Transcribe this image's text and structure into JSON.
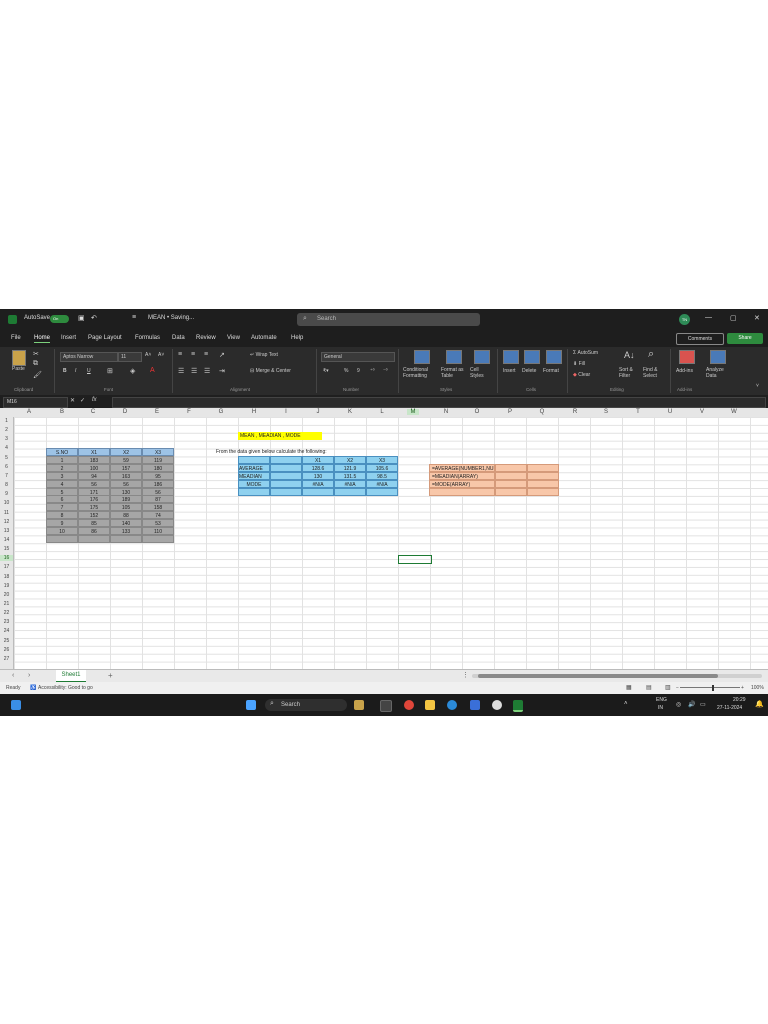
{
  "titlebar": {
    "autosave_label": "AutoSave",
    "autosave_state": "On",
    "doc_title": "MEAN • Saving...",
    "search_placeholder": "Search",
    "user_initials": "TN",
    "minimize": "—",
    "maximize": "▢",
    "close": "✕"
  },
  "menu": {
    "items": [
      "File",
      "Home",
      "Insert",
      "Page Layout",
      "Formulas",
      "Data",
      "Review",
      "View",
      "Automate",
      "Help"
    ],
    "active": "Home",
    "comments_label": "Comments",
    "share_label": "Share"
  },
  "ribbon": {
    "paste": "Paste",
    "font_name": "Aptos Narrow",
    "font_size": "11",
    "wrap_text": "Wrap Text",
    "merge_center": "Merge & Center",
    "number_format": "General",
    "conditional_formatting": "Conditional Formatting",
    "format_as_table": "Format as Table",
    "cell_styles": "Cell Styles",
    "insert": "Insert",
    "delete": "Delete",
    "format": "Format",
    "autosum": "AutoSum",
    "fill": "Fill",
    "clear": "Clear",
    "sort_filter": "Sort & Filter",
    "find_select": "Find & Select",
    "addins": "Add-ins",
    "analyze_data": "Analyze Data",
    "groups": [
      "Clipboard",
      "Font",
      "Alignment",
      "Number",
      "Styles",
      "Cells",
      "Editing",
      "Add-ins"
    ]
  },
  "formula_bar": {
    "name_box": "M16",
    "fx": "fx",
    "content": ""
  },
  "columns": [
    "A",
    "B",
    "C",
    "D",
    "E",
    "F",
    "G",
    "H",
    "I",
    "J",
    "K",
    "L",
    "M",
    "N",
    "O",
    "P",
    "Q",
    "R",
    "S",
    "T",
    "U",
    "V",
    "W"
  ],
  "selected_column": "M",
  "rows": [
    "1",
    "2",
    "3",
    "4",
    "5",
    "6",
    "7",
    "8",
    "9",
    "10",
    "11",
    "12",
    "13",
    "14",
    "15",
    "16",
    "17",
    "18",
    "19",
    "20",
    "21",
    "22",
    "23",
    "24",
    "25",
    "26",
    "27"
  ],
  "selected_row": "16",
  "data_table": {
    "headers": [
      "S.NO",
      "X1",
      "X2",
      "X3"
    ],
    "rows": [
      [
        "1",
        "183",
        "59",
        "119"
      ],
      [
        "2",
        "100",
        "157",
        "180"
      ],
      [
        "3",
        "94",
        "163",
        "95"
      ],
      [
        "4",
        "56",
        "56",
        "186"
      ],
      [
        "5",
        "171",
        "130",
        "56"
      ],
      [
        "6",
        "176",
        "189",
        "87"
      ],
      [
        "7",
        "175",
        "105",
        "158"
      ],
      [
        "8",
        "152",
        "88",
        "74"
      ],
      [
        "9",
        "85",
        "140",
        "53"
      ],
      [
        "10",
        "86",
        "133",
        "110"
      ]
    ]
  },
  "title_cell": "MEAN , MEADIAN , MODE",
  "instruction": "From the data given below calculate the following:",
  "results": {
    "headers": [
      "X1",
      "X2",
      "X3"
    ],
    "rows": [
      {
        "label": "AVERAGE",
        "values": [
          "128.6",
          "121.9",
          "105.6"
        ]
      },
      {
        "label": "MEADIAN",
        "values": [
          "130",
          "131.5",
          "98.5"
        ]
      },
      {
        "label": "MODE",
        "values": [
          "#N/A",
          "#N/A",
          "#N/A"
        ]
      }
    ]
  },
  "formulas": [
    "=AVERAGE(NUMBER1,NUMBER2)",
    "=MEADIAN(ARRAY)",
    "=MODE(ARRAY)"
  ],
  "sheet_tab": "Sheet1",
  "add_sheet": "+",
  "status": {
    "ready": "Ready",
    "accessibility": "Accessibility: Good to go",
    "zoom": "100%"
  },
  "taskbar": {
    "search": "Search",
    "lang": "ENG",
    "region": "IN",
    "time": "20:29",
    "date": "27-11-2024"
  },
  "colors": {
    "excel_green": "#1e7b34",
    "gray_table": "#a6a6a6",
    "results_blue": "#8fd1ef",
    "formula_salmon": "#f8c7a9",
    "title_yellow": "#ffff00"
  }
}
